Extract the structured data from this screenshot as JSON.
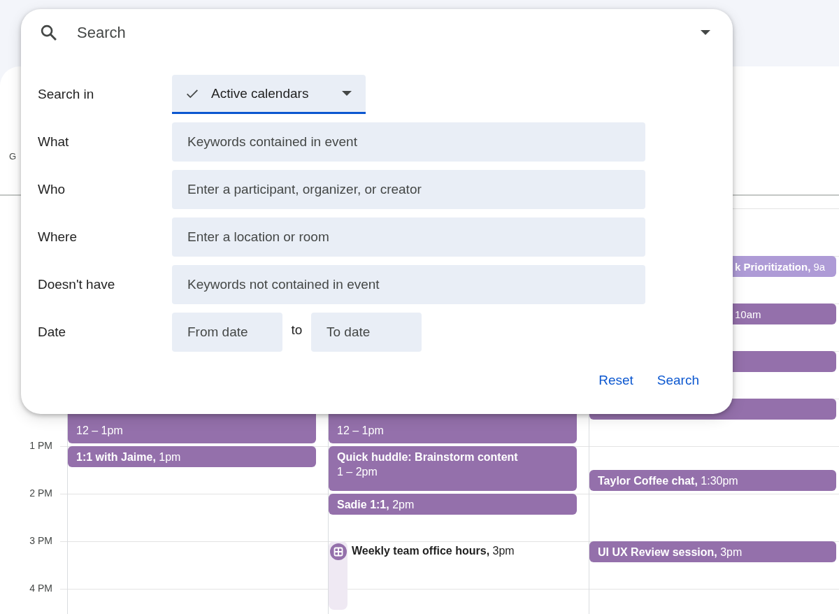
{
  "calendar": {
    "timezone": "G",
    "rows": [
      {
        "cells": [
          {},
          {},
          {}
        ]
      },
      {
        "cells": [
          {},
          {},
          {
            "events": [
              {
                "kind": "short",
                "half_past": false,
                "color": "#ae9bd6",
                "clipped": true,
                "label": "**k Prioritization,** 9a"
              }
            ]
          }
        ]
      },
      {
        "cells": [
          {},
          {},
          {
            "events": [
              {
                "kind": "short",
                "half_past": false,
                "color": "#9470ab",
                "clipped": true,
                "label": "10am"
              }
            ]
          }
        ]
      },
      {
        "cells": [
          {},
          {},
          {
            "events": [
              {
                "kind": "short",
                "half_past": false,
                "color": "#9470ab"
              }
            ]
          }
        ]
      },
      {
        "cells": [
          {
            "events": [
              {
                "kind": "long",
                "half_past": false,
                "color": "#9470ab",
                "clipped": false,
                "time": "12 – 1pm"
              }
            ]
          },
          {
            "events": [
              {
                "kind": "long",
                "half_past": false,
                "color": "#9470ab",
                "clipped": false,
                "time": "12 – 1pm"
              }
            ]
          },
          {
            "events": [
              {
                "kind": "short",
                "half_past": false,
                "color": "#9470ab"
              }
            ]
          }
        ]
      },
      {
        "label": "1 PM",
        "cells": [
          {
            "events": [
              {
                "kind": "short",
                "half_past": false,
                "color": "#9470ab",
                "clipped": false,
                "label": "**1:1 with Jaime,** 1pm"
              }
            ]
          },
          {
            "events": [
              {
                "kind": "long",
                "half_past": false,
                "color": "#9470ab",
                "clipped": false,
                "title": "Quick huddle: Brainstorm content",
                "time": "1 – 2pm"
              }
            ]
          },
          {
            "events": [
              {
                "kind": "short",
                "half_past": true,
                "color": "#9470ab",
                "clipped": false,
                "label": "**Taylor Coffee chat,** 1:30pm"
              }
            ]
          }
        ]
      },
      {
        "label": "2 PM",
        "cells": [
          {},
          {
            "events": [
              {
                "kind": "short",
                "half_past": false,
                "color": "#9470ab",
                "clipped": false,
                "label": "**Sadie 1:1,** 2pm"
              }
            ]
          },
          {}
        ]
      },
      {
        "label": "3 PM",
        "cells": [
          {},
          {
            "events": [
              {
                "kind": "task",
                "half_past": false,
                "color": "#9470ab",
                "label": "**Weekly team office hours,** 3pm"
              }
            ]
          },
          {
            "events": [
              {
                "kind": "short",
                "half_past": false,
                "color": "#9470ab",
                "clipped": false,
                "label": "**UI UX Review session,** 3pm"
              }
            ]
          }
        ]
      },
      {
        "label": "4 PM",
        "cells": [
          {},
          {},
          {}
        ]
      }
    ]
  },
  "search": {
    "placeholder": "Search"
  },
  "form": {
    "rows": [
      {
        "label": "Search in",
        "kind": "select",
        "value": "Active calendars",
        "checked": true
      },
      {
        "label": "What",
        "kind": "text",
        "placeholder": "Keywords contained in event"
      },
      {
        "label": "Who",
        "kind": "text",
        "placeholder": "Enter a participant, organizer, or creator"
      },
      {
        "label": "Where",
        "kind": "text",
        "placeholder": "Enter a location or room"
      },
      {
        "label": "Doesn't have",
        "kind": "text",
        "placeholder": "Keywords not contained in event"
      },
      {
        "label": "Date",
        "kind": "date_range",
        "from_placeholder": "From date",
        "separator": "to",
        "to_placeholder": "To date"
      }
    ]
  },
  "buttons": [
    "Reset",
    "Search"
  ]
}
